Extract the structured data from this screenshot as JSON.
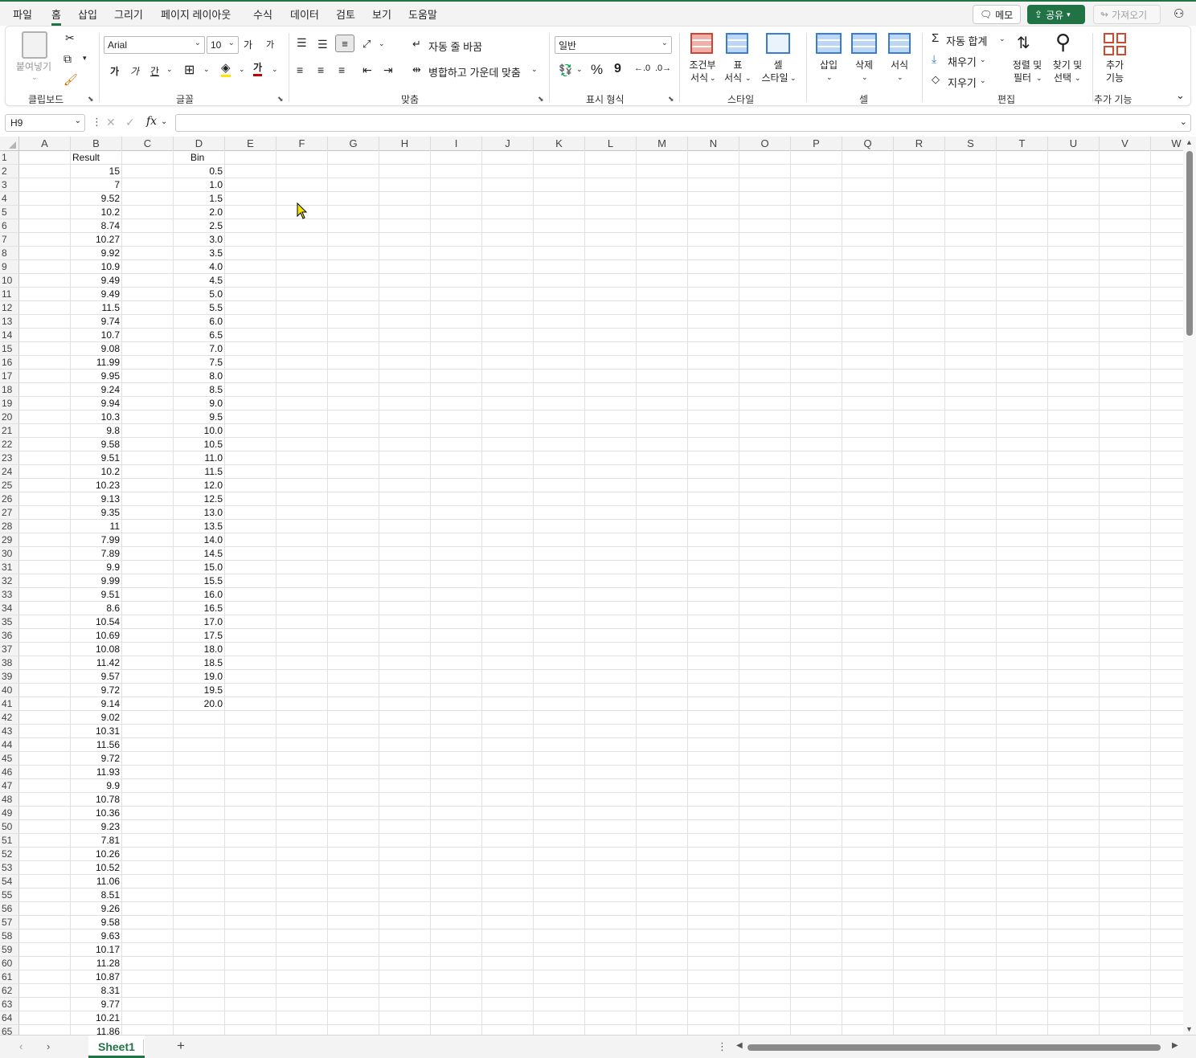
{
  "menu": {
    "items": [
      "파일",
      "홈",
      "삽입",
      "그리기",
      "페이지 레이아웃",
      "수식",
      "데이터",
      "검토",
      "보기",
      "도움말"
    ],
    "active": "홈",
    "memo_label": "메모",
    "share_label": "공유",
    "import_label": "가져오기"
  },
  "ribbon": {
    "clipboard": {
      "paste_label": "붙여넣기",
      "group_label": "클립보드"
    },
    "font": {
      "name": "Arial",
      "size": "10",
      "grow": "가",
      "shrink": "가",
      "bold": "가",
      "italic": "가",
      "underline": "간",
      "font_color_glyph": "가",
      "group_label": "글꼴"
    },
    "alignment": {
      "wrap_label": "자동 줄 바꿈",
      "merge_label": "병합하고 가운데 맞춤",
      "group_label": "맞춤"
    },
    "number": {
      "format": "일반",
      "percent": "%",
      "comma": "9",
      "group_label": "표시 형식"
    },
    "styles": {
      "conditional_label_1": "조건부",
      "conditional_label_2": "서식",
      "table_label_1": "표",
      "table_label_2": "서식",
      "cell_label_1": "셀",
      "cell_label_2": "스타일",
      "group_label": "스타일"
    },
    "cells": {
      "insert_label": "삽입",
      "delete_label": "삭제",
      "format_label": "서식",
      "group_label": "셀"
    },
    "editing": {
      "autosum_label": "자동 합계",
      "fill_label": "채우기",
      "clear_label": "지우기",
      "sort_label_1": "정렬 및",
      "sort_label_2": "필터",
      "find_label_1": "찾기 및",
      "find_label_2": "선택",
      "group_label": "편집"
    },
    "addins": {
      "label_1": "추가",
      "label_2": "기능",
      "group_label": "추가 기능"
    }
  },
  "formula_bar": {
    "name_box": "H9",
    "fx": "fx",
    "formula": ""
  },
  "columns": [
    "A",
    "B",
    "C",
    "D",
    "E",
    "F",
    "G",
    "H",
    "I",
    "J",
    "K",
    "L",
    "M",
    "N",
    "O",
    "P",
    "Q",
    "R",
    "S",
    "T",
    "U",
    "V",
    "W"
  ],
  "rows": [
    "1",
    "2",
    "3",
    "4",
    "5",
    "6",
    "7",
    "8",
    "9",
    "10",
    "11",
    "12",
    "13",
    "14",
    "15",
    "16",
    "17",
    "18",
    "19",
    "20",
    "21",
    "22",
    "23",
    "24",
    "25",
    "26",
    "27",
    "28",
    "29",
    "30",
    "31",
    "32",
    "33",
    "34",
    "35",
    "36",
    "37",
    "38",
    "39",
    "40",
    "41",
    "42",
    "43",
    "44",
    "45",
    "46",
    "47",
    "48",
    "49",
    "50",
    "51",
    "52",
    "53",
    "54",
    "55",
    "56",
    "57",
    "58",
    "59",
    "60",
    "61",
    "62",
    "63",
    "64",
    "65"
  ],
  "headers": {
    "B1": "Result",
    "D1": "Bin"
  },
  "colB": [
    "15",
    "7",
    "9.52",
    "10.2",
    "8.74",
    "10.27",
    "9.92",
    "10.9",
    "9.49",
    "9.49",
    "11.5",
    "9.74",
    "10.7",
    "9.08",
    "11.99",
    "9.95",
    "9.24",
    "9.94",
    "10.3",
    "9.8",
    "9.58",
    "9.51",
    "10.2",
    "10.23",
    "9.13",
    "9.35",
    "11",
    "7.99",
    "7.89",
    "9.9",
    "9.99",
    "9.51",
    "8.6",
    "10.54",
    "10.69",
    "10.08",
    "11.42",
    "9.57",
    "9.72",
    "9.14",
    "9.02",
    "10.31",
    "11.56",
    "9.72",
    "11.93",
    "9.9",
    "10.78",
    "10.36",
    "9.23",
    "7.81",
    "10.26",
    "10.52",
    "11.06",
    "8.51",
    "9.26",
    "9.58",
    "9.63",
    "10.17",
    "11.28",
    "10.87",
    "8.31",
    "9.77",
    "10.21",
    "11.86"
  ],
  "colD": [
    "0.5",
    "1.0",
    "1.5",
    "2.0",
    "2.5",
    "3.0",
    "3.5",
    "4.0",
    "4.5",
    "5.0",
    "5.5",
    "6.0",
    "6.5",
    "7.0",
    "7.5",
    "8.0",
    "8.5",
    "9.0",
    "9.5",
    "10.0",
    "10.5",
    "11.0",
    "11.5",
    "12.0",
    "12.5",
    "13.0",
    "13.5",
    "14.0",
    "14.5",
    "15.0",
    "15.5",
    "16.0",
    "16.5",
    "17.0",
    "17.5",
    "18.0",
    "18.5",
    "19.0",
    "19.5",
    "20.0"
  ],
  "sheet": {
    "tab_label": "Sheet1",
    "add_label": "+"
  },
  "colors": {
    "accent": "#217346",
    "grid": "#e1e1e1",
    "header_bg": "#f3f3f3"
  }
}
